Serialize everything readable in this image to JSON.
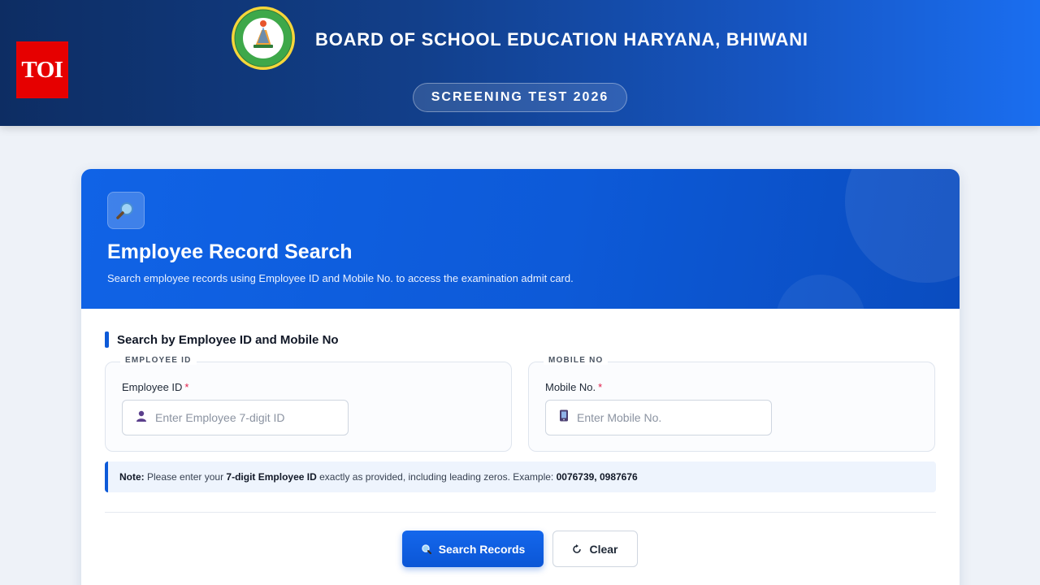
{
  "header": {
    "badge": "TOI",
    "board_title": "BOARD OF SCHOOL EDUCATION HARYANA, BHIWANI",
    "screening_label": "SCREENING TEST 2026",
    "colors": {
      "header_start": "#0d2d63",
      "header_end": "#1a6ef0",
      "badge": "#e60000"
    }
  },
  "card": {
    "icon": "search-icon",
    "title": "Employee Record Search",
    "subtitle": "Search employee records using Employee ID and Mobile No. to access the examination admit card.",
    "section_title": "Search by Employee ID and Mobile No",
    "fields": [
      {
        "legend": "EMPLOYEE ID",
        "label": "Employee ID",
        "required_mark": "*",
        "icon": "user-icon",
        "placeholder": "Enter Employee 7-digit ID",
        "value": ""
      },
      {
        "legend": "MOBILE NO",
        "label": "Mobile No.",
        "required_mark": "*",
        "icon": "mobile-phone-icon",
        "placeholder": "Enter Mobile No.",
        "value": ""
      }
    ],
    "note": {
      "prefix": "Note:",
      "text_1": " Please enter your ",
      "emphasis": "7-digit Employee ID",
      "text_2": " exactly as provided, including leading zeros. Example: ",
      "examples": "0076739, 0987676"
    },
    "buttons": {
      "search_label": "Search Records",
      "clear_label": "Clear"
    },
    "colors": {
      "accent": "#0d5ad8",
      "required": "#e11d48"
    }
  }
}
